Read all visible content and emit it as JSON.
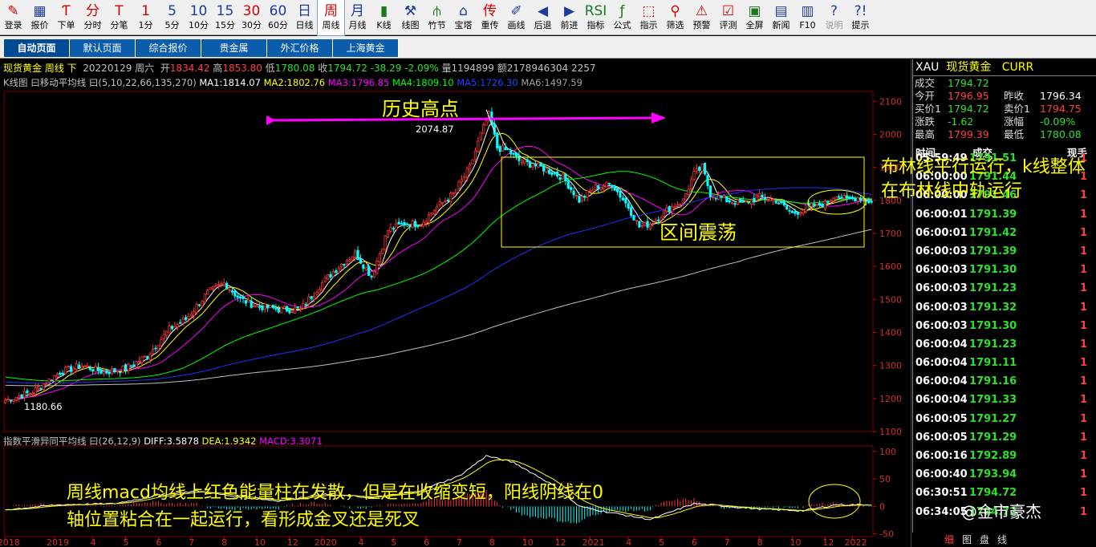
{
  "toolbar": [
    {
      "icon": "✎",
      "label": "登录"
    },
    {
      "icon": "▦",
      "label": "报价"
    },
    {
      "icon": "Ƭ",
      "label": "下单"
    },
    {
      "icon": "分",
      "label": "分时"
    },
    {
      "icon": "T",
      "label": "分笔"
    },
    {
      "icon": "1",
      "label": "1分"
    },
    {
      "icon": "5",
      "label": "5分"
    },
    {
      "icon": "10",
      "label": "10分"
    },
    {
      "icon": "15",
      "label": "15分"
    },
    {
      "icon": "30",
      "label": "30分"
    },
    {
      "icon": "60",
      "label": "60分"
    },
    {
      "icon": "日",
      "label": "日线"
    },
    {
      "icon": "周",
      "label": "周线"
    },
    {
      "icon": "月",
      "label": "月线"
    },
    {
      "icon": "▮",
      "label": "K线"
    },
    {
      "icon": "⚒",
      "label": "线图"
    },
    {
      "icon": "⫛",
      "label": "竹节"
    },
    {
      "icon": "⌂",
      "label": "宝塔"
    },
    {
      "icon": "传",
      "label": "重传"
    },
    {
      "icon": "✐",
      "label": "画线"
    },
    {
      "icon": "◀",
      "label": "后退"
    },
    {
      "icon": "▶",
      "label": "前进"
    },
    {
      "icon": "RSI",
      "label": "指标"
    },
    {
      "icon": "ƒ",
      "label": "公式"
    },
    {
      "icon": "⬚",
      "label": "指示"
    },
    {
      "icon": "⚲",
      "label": "筛选"
    },
    {
      "icon": "⚠",
      "label": "预警"
    },
    {
      "icon": "☑",
      "label": "评测"
    },
    {
      "icon": "▣",
      "label": "全屏"
    },
    {
      "icon": "▤",
      "label": "新闻"
    },
    {
      "icon": "▥",
      "label": "F10"
    },
    {
      "icon": "?",
      "label": "说明"
    },
    {
      "icon": "?!",
      "label": "提示"
    }
  ],
  "tabs": [
    "自动页面",
    "默认页面",
    "综合报价",
    "贵金属",
    "外汇价格",
    "上海黄金"
  ],
  "info": {
    "name": "现货黄金 周线 下",
    "date": "20220129 周六",
    "open_l": "开",
    "open": "1834.42",
    "high_l": "高",
    "high": "1853.80",
    "low_l": "低",
    "low": "1780.08",
    "close_l": "收",
    "close": "1794.72",
    "change": "-38.29",
    "pct": "-2.09%",
    "vol": "量1194899",
    "amt": "额2178946304",
    "extra": "2257"
  },
  "ma_legend": {
    "title": "K线图 曰移动平均线 曰(5,10,22,66,135,270)",
    "ma1": "MA1:1814.07",
    "ma2": "MA2:1802.76",
    "ma3": "MA3:1796.85",
    "ma4": "MA4:1809.10",
    "ma5": "MA5:1726.30",
    "ma6": "MA6:1497.59"
  },
  "macd_legend": {
    "title": "指数平滑异同平均线 曰(26,12,9)",
    "diff": "DIFF:3.5878",
    "dea": "DEA:1.9342",
    "macd": "MACD:3.3071"
  },
  "quote": {
    "symbol": "XAU",
    "name": "现货黄金",
    "type": "CURR",
    "rows": [
      {
        "l1": "成交",
        "v1": "1794.72",
        "l2": "",
        "v2": ""
      },
      {
        "l1": "今开",
        "v1": "1796.95",
        "l2": "昨收",
        "v2": "1796.34"
      },
      {
        "l1": "买价1",
        "v1": "1794.72",
        "l2": "卖价1",
        "v2": "1794.75"
      },
      {
        "l1": "涨跌",
        "v1": "-1.62",
        "l2": "涨幅",
        "v2": "-0.09%"
      },
      {
        "l1": "最高",
        "v1": "1799.39",
        "l2": "最低",
        "v2": "1780.08"
      }
    ],
    "tick_head": [
      "时间",
      "成交",
      "现手"
    ],
    "ticks": [
      [
        "05:59:49",
        "1791.51",
        "1"
      ],
      [
        "06:00:00",
        "1791.44",
        "1"
      ],
      [
        "06:00:00",
        "1791.46",
        "1"
      ],
      [
        "06:00:01",
        "1791.39",
        "1"
      ],
      [
        "06:00:01",
        "1791.42",
        "1"
      ],
      [
        "06:00:03",
        "1791.39",
        "1"
      ],
      [
        "06:00:03",
        "1791.30",
        "1"
      ],
      [
        "06:00:03",
        "1791.23",
        "1"
      ],
      [
        "06:00:03",
        "1791.32",
        "1"
      ],
      [
        "06:00:03",
        "1791.30",
        "1"
      ],
      [
        "06:00:04",
        "1791.23",
        "1"
      ],
      [
        "06:00:04",
        "1791.11",
        "1"
      ],
      [
        "06:00:04",
        "1791.16",
        "1"
      ],
      [
        "06:00:04",
        "1791.33",
        "1"
      ],
      [
        "06:00:05",
        "1791.27",
        "1"
      ],
      [
        "06:00:05",
        "1791.29",
        "1"
      ],
      [
        "06:00:16",
        "1792.89",
        "1"
      ],
      [
        "06:00:40",
        "1793.94",
        "1"
      ],
      [
        "06:30:51",
        "1794.72",
        "1"
      ],
      [
        "06:34:05",
        "1794.72",
        "1"
      ]
    ],
    "bottom_nav": [
      "细",
      "图",
      "盘",
      "线"
    ]
  },
  "annotations": {
    "ath": "历史高点",
    "ath_value": "2074.87",
    "low_value": "1180.66",
    "range": "区间震荡",
    "boll": "布林线平行运行，k线整体在布林线中轨运行",
    "macd_note_1": "周线macd均线上红色能量柱在发散，但是在收缩变短，阳线阴线在0",
    "macd_note_2": "轴位置粘合在一起运行，看形成金叉还是死叉",
    "watermark": "@金市豪杰"
  },
  "axis": {
    "price_ticks": [
      "2100",
      "2000",
      "1900",
      "1800",
      "1700",
      "1600",
      "1500",
      "1400",
      "1300",
      "1200",
      "1100"
    ],
    "macd_ticks": [
      "100",
      "50",
      "0",
      "-50"
    ],
    "x_ticks": [
      {
        "label": "2018",
        "i": 0
      },
      {
        "label": "2019",
        "i": 18
      },
      {
        "label": "4",
        "i": 32
      },
      {
        "label": "5",
        "i": 44
      },
      {
        "label": "6",
        "i": 56
      },
      {
        "label": "7",
        "i": 68
      },
      {
        "label": "8",
        "i": 80
      },
      {
        "label": "10",
        "i": 92
      },
      {
        "label": "12",
        "i": 104
      },
      {
        "label": "2020",
        "i": 116
      },
      {
        "label": "4",
        "i": 130
      },
      {
        "label": "5",
        "i": 142
      },
      {
        "label": "6",
        "i": 154
      },
      {
        "label": "7",
        "i": 166
      },
      {
        "label": "8",
        "i": 178
      },
      {
        "label": "10",
        "i": 190
      },
      {
        "label": "12",
        "i": 202
      },
      {
        "label": "2021",
        "i": 214
      },
      {
        "label": "4",
        "i": 228
      },
      {
        "label": "5",
        "i": 240
      },
      {
        "label": "6",
        "i": 252
      },
      {
        "label": "7",
        "i": 264
      },
      {
        "label": "8",
        "i": 276
      },
      {
        "label": "10",
        "i": 288
      },
      {
        "label": "12",
        "i": 300
      },
      {
        "label": "2022",
        "i": 310
      }
    ]
  },
  "colors": {
    "up": "#ff3333",
    "down": "#00ffff",
    "ma1": "#ffffff",
    "ma2": "#ffff00",
    "ma3": "#ff00ff",
    "ma4": "#00ff00",
    "ma5": "#2030ff",
    "ma6": "#c0c0c0",
    "annotation": "#ffff00",
    "arrow": "#ff00ff"
  },
  "chart_data": {
    "type": "candlestick",
    "price_range": [
      1100,
      2130
    ],
    "macd_range": [
      -55,
      110
    ],
    "n_bars": 318,
    "anchors": [
      [
        0,
        1195
      ],
      [
        10,
        1220
      ],
      [
        20,
        1280
      ],
      [
        28,
        1300
      ],
      [
        36,
        1280
      ],
      [
        44,
        1290
      ],
      [
        52,
        1330
      ],
      [
        60,
        1410
      ],
      [
        66,
        1440
      ],
      [
        74,
        1520
      ],
      [
        80,
        1550
      ],
      [
        86,
        1500
      ],
      [
        92,
        1480
      ],
      [
        100,
        1470
      ],
      [
        108,
        1470
      ],
      [
        116,
        1550
      ],
      [
        122,
        1600
      ],
      [
        128,
        1640
      ],
      [
        134,
        1570
      ],
      [
        140,
        1710
      ],
      [
        146,
        1730
      ],
      [
        152,
        1730
      ],
      [
        158,
        1780
      ],
      [
        164,
        1820
      ],
      [
        170,
        1900
      ],
      [
        174,
        2000
      ],
      [
        177,
        2060
      ],
      [
        180,
        1960
      ],
      [
        184,
        1950
      ],
      [
        188,
        1920
      ],
      [
        196,
        1900
      ],
      [
        204,
        1870
      ],
      [
        210,
        1800
      ],
      [
        216,
        1840
      ],
      [
        222,
        1850
      ],
      [
        228,
        1780
      ],
      [
        232,
        1720
      ],
      [
        236,
        1730
      ],
      [
        242,
        1770
      ],
      [
        248,
        1800
      ],
      [
        252,
        1880
      ],
      [
        255,
        1900
      ],
      [
        258,
        1820
      ],
      [
        264,
        1800
      ],
      [
        270,
        1790
      ],
      [
        276,
        1810
      ],
      [
        282,
        1800
      ],
      [
        288,
        1760
      ],
      [
        294,
        1780
      ],
      [
        300,
        1790
      ],
      [
        304,
        1820
      ],
      [
        308,
        1800
      ],
      [
        312,
        1810
      ],
      [
        317,
        1795
      ]
    ],
    "macd_anchors": [
      [
        0,
        -6
      ],
      [
        20,
        3
      ],
      [
        40,
        5
      ],
      [
        56,
        20
      ],
      [
        70,
        28
      ],
      [
        84,
        18
      ],
      [
        100,
        10
      ],
      [
        116,
        22
      ],
      [
        134,
        16
      ],
      [
        150,
        26
      ],
      [
        166,
        55
      ],
      [
        176,
        92
      ],
      [
        186,
        80
      ],
      [
        200,
        40
      ],
      [
        210,
        0
      ],
      [
        220,
        -10
      ],
      [
        236,
        -24
      ],
      [
        252,
        5
      ],
      [
        260,
        2
      ],
      [
        276,
        -5
      ],
      [
        292,
        -8
      ],
      [
        304,
        3
      ],
      [
        317,
        3
      ]
    ],
    "ma_settings": [
      5,
      10,
      22,
      66,
      135,
      270
    ]
  }
}
